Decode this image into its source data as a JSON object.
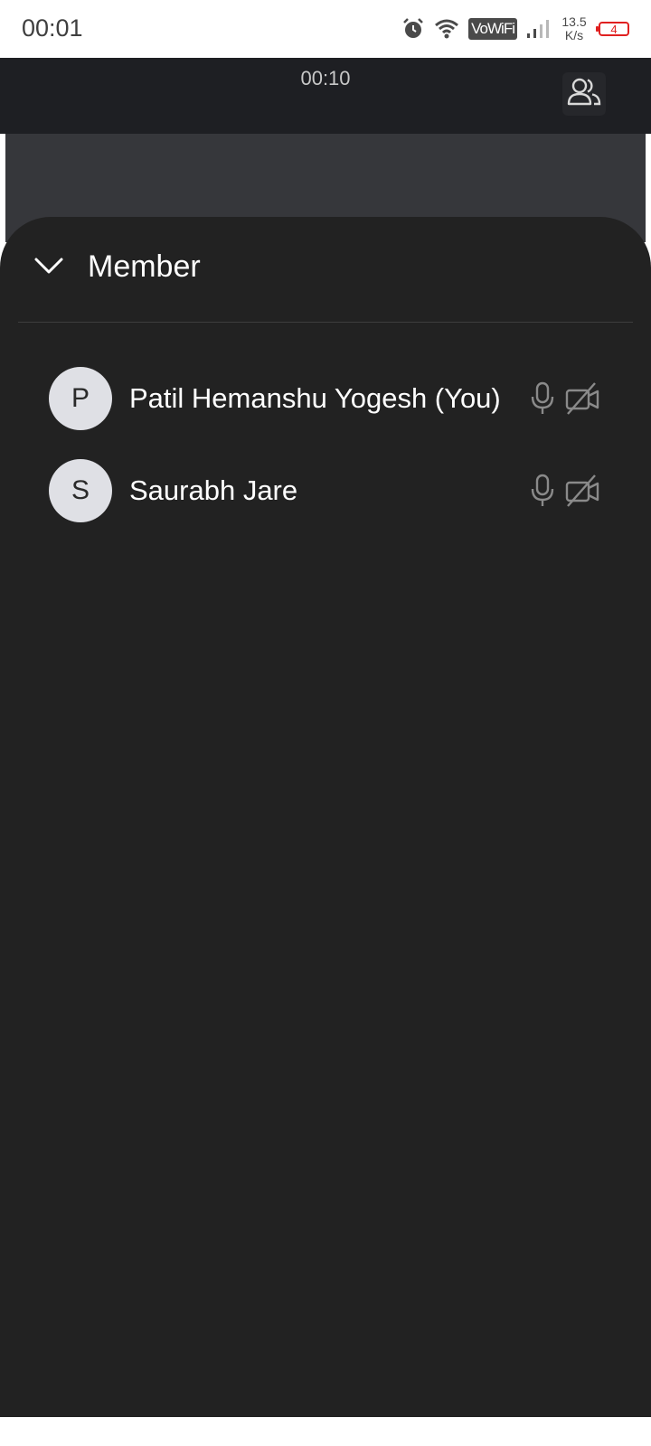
{
  "status_bar": {
    "time": "00:01",
    "network_label": "VoWiFi",
    "speed_value": "13.5",
    "speed_unit": "K/s",
    "battery_level": "4",
    "icons": [
      "alarm-icon",
      "wifi-icon",
      "signal-icon"
    ]
  },
  "call": {
    "timer": "00:10",
    "members_icon": "people-icon"
  },
  "sheet": {
    "title": "Member",
    "collapse_icon": "chevron-down-icon"
  },
  "members": [
    {
      "initial": "P",
      "name": "Patil Hemanshu Yogesh (You)",
      "mic": "mic-icon",
      "camera": "camera-off-icon"
    },
    {
      "initial": "S",
      "name": "Saurabh Jare",
      "mic": "mic-icon",
      "camera": "camera-off-icon"
    }
  ],
  "colors": {
    "sheet_bg": "#222222",
    "header_bg": "#1e1f23",
    "avatar_bg": "#dfe0e5",
    "battery_low": "#e02020"
  }
}
